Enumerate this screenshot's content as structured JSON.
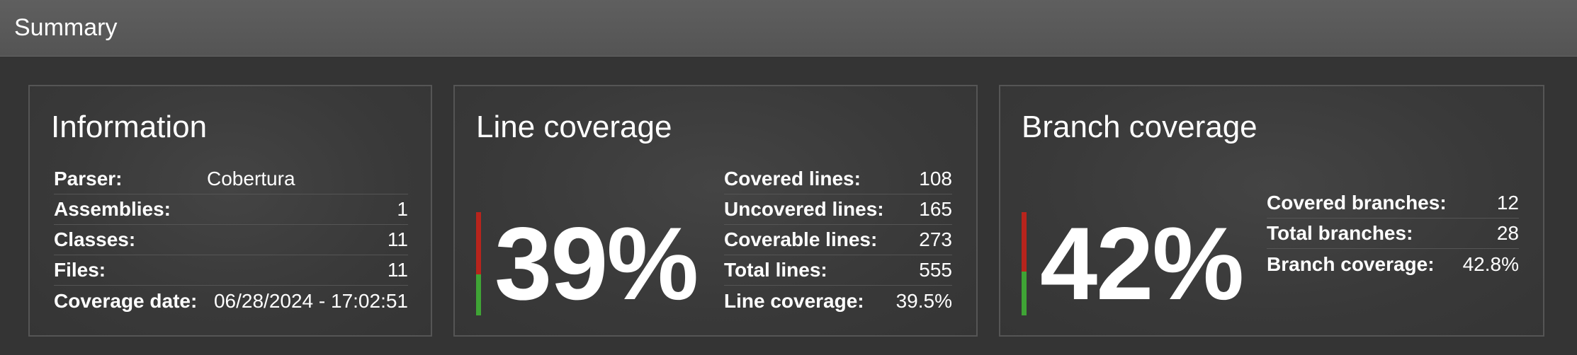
{
  "header": {
    "title": "Summary"
  },
  "information": {
    "title": "Information",
    "rows": [
      {
        "label": "Parser:",
        "value": "Cobertura"
      },
      {
        "label": "Assemblies:",
        "value": "1"
      },
      {
        "label": "Classes:",
        "value": "11"
      },
      {
        "label": "Files:",
        "value": "11"
      },
      {
        "label": "Coverage date:",
        "value": "06/28/2024 - 17:02:51"
      }
    ]
  },
  "line_coverage": {
    "title": "Line coverage",
    "percent_label": "39%",
    "fraction_covered": 0.395,
    "rows": [
      {
        "label": "Covered lines:",
        "value": "108"
      },
      {
        "label": "Uncovered lines:",
        "value": "165"
      },
      {
        "label": "Coverable lines:",
        "value": "273"
      },
      {
        "label": "Total lines:",
        "value": "555"
      },
      {
        "label": "Line coverage:",
        "value": "39.5%"
      }
    ]
  },
  "branch_coverage": {
    "title": "Branch coverage",
    "percent_label": "42%",
    "fraction_covered": 0.428,
    "rows": [
      {
        "label": "Covered branches:",
        "value": "12"
      },
      {
        "label": "Total branches:",
        "value": "28"
      },
      {
        "label": "Branch coverage:",
        "value": "42.8%"
      }
    ]
  },
  "colors": {
    "covered": "#3fa435",
    "uncovered": "#b8241c",
    "background": "#343434",
    "header": "#5a5a5a"
  }
}
